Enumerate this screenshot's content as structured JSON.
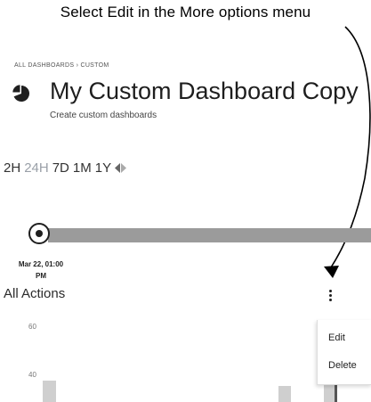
{
  "caption": "Select Edit in the More options menu",
  "breadcrumb": "ALL DASHBOARDS › CUSTOM",
  "dashboard": {
    "title": "My Custom Dashboard Copy",
    "subtitle": "Create custom dashboards"
  },
  "time_ranges": [
    "2H",
    "24H",
    "7D",
    "1M",
    "1Y"
  ],
  "active_range": "24H",
  "timeline": {
    "date_line1": "Mar 22, 01:00",
    "date_line2": "PM"
  },
  "widget": {
    "title": "All Actions",
    "y_ticks": [
      "60",
      "40"
    ]
  },
  "more_menu": {
    "items": [
      "Edit",
      "Delete"
    ]
  },
  "colors": {
    "accent_dark": "#1f1f1f",
    "timeline_bar": "#9b9b9b",
    "inactive_range": "#9aa0a8",
    "chart_bar": "#cfcfcf"
  }
}
